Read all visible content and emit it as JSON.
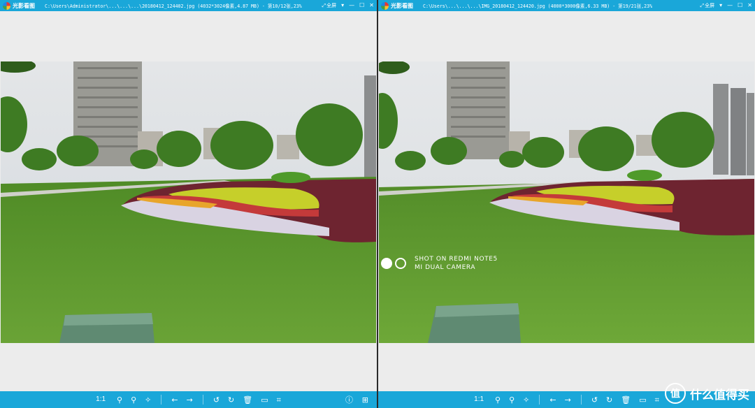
{
  "left_window": {
    "app_name": "光影看图",
    "path": "C:\\Users\\Administrator\\...\\...\\...\\20180412_124402.jpg (4032*3024像素,4.87 MB) - 第10/12张,23%",
    "fullscreen_label": "全屏"
  },
  "right_window": {
    "app_name": "光影看图",
    "path": "C:\\Users\\...\\...\\...\\IMG_20180412_124420.jpg (4000*3000像素,6.33 MB) - 第19/21张,23%",
    "fullscreen_label": "全屏",
    "watermark_line1": "SHOT ON REDMI NOTE5",
    "watermark_line2": "MI DUAL CAMERA"
  },
  "toolbar": {
    "zoom_label": "1:1",
    "icons": [
      "zoom-in-icon",
      "zoom-out-icon",
      "magic-wand-icon",
      "arrow-left-icon",
      "arrow-right-icon",
      "rotate-left-icon",
      "rotate-right-icon",
      "delete-icon",
      "folder-icon",
      "crop-icon",
      "info-icon",
      "grid-icon"
    ]
  },
  "brand": {
    "logo_glyph": "值",
    "name": "什么值得买"
  },
  "colors": {
    "titlebar": "#1aa7d9",
    "viewer_bg": "#ececec",
    "grass": "#5f9a2c",
    "foliage": "#3f7f22",
    "sky": "#dde3e8"
  }
}
